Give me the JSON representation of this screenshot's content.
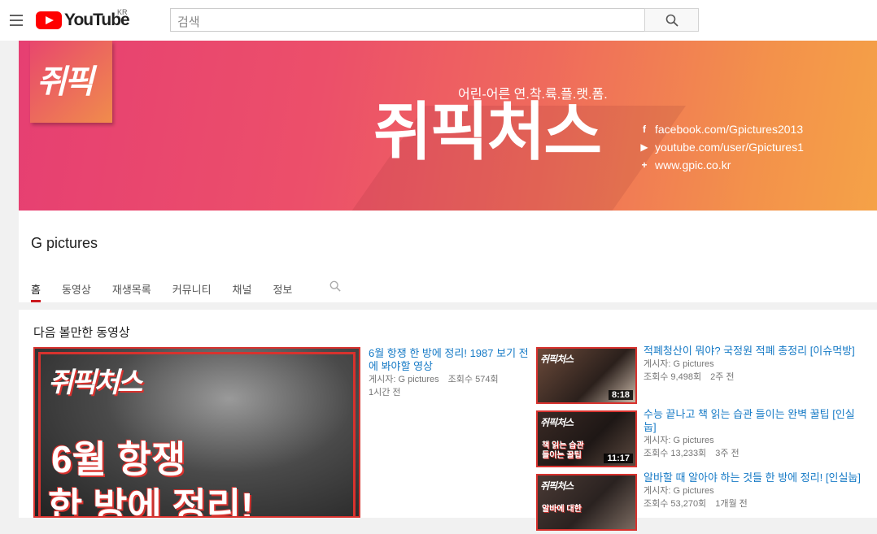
{
  "masthead": {
    "logo_text": "YouTube",
    "region": "KR",
    "search_placeholder": "검색"
  },
  "banner": {
    "channel_logo_text": "쥐픽",
    "title": "쥐픽처스",
    "tagline": "어린-어른 연.착.륙.플.랫.폼.",
    "links": [
      {
        "icon": "f",
        "text": "facebook.com/Gpictures2013"
      },
      {
        "icon": "▶",
        "text": "youtube.com/user/Gpictures1"
      },
      {
        "icon": "+",
        "text": "www.gpic.co.kr"
      }
    ]
  },
  "channel": {
    "name": "G pictures",
    "tabs": [
      "홈",
      "동영상",
      "재생목록",
      "커뮤니티",
      "채널",
      "정보"
    ]
  },
  "shelf": {
    "title": "다음 볼만한 동영상",
    "featured": {
      "thumb_brand": "쥐픽처스",
      "thumb_line1": "6월 항쟁",
      "thumb_line2": "한 방에 정리!",
      "title": "6월 항쟁 한 방에 정리! 1987 보기 전에 봐야할 영상",
      "uploader": "게시자: G pictures",
      "views": "조회수 574회",
      "age": "1시간 전"
    },
    "videos": [
      {
        "title": "적폐청산이 뭐야? 국정원 적폐 총정리 [이슈먹방]",
        "uploader": "게시자: G pictures",
        "views": "조회수 9,498회",
        "age": "2주 전",
        "duration": "8:18",
        "thumb_brand": "쥐픽처스",
        "thumb_caption": ""
      },
      {
        "title": "수능 끝나고 책 읽는 습관 들이는 완벽 꿀팁 [인실눕]",
        "uploader": "게시자: G pictures",
        "views": "조회수 13,233회",
        "age": "3주 전",
        "duration": "11:17",
        "thumb_brand": "쥐픽처스",
        "thumb_caption": "책 읽는 습관 들이는 꿀팁"
      },
      {
        "title": "알바할 때 알아야 하는 것들 한 방에 정리! [인실눕]",
        "uploader": "게시자: G pictures",
        "views": "조회수 53,270회",
        "age": "1개월 전",
        "duration": "",
        "thumb_brand": "쥐픽처스",
        "thumb_caption": "알바에 대한"
      }
    ]
  },
  "colors": {
    "accent_red": "#cc181e",
    "link_blue": "#167ac6",
    "banner_pink": "#e63f72",
    "banner_orange": "#f5a247"
  }
}
